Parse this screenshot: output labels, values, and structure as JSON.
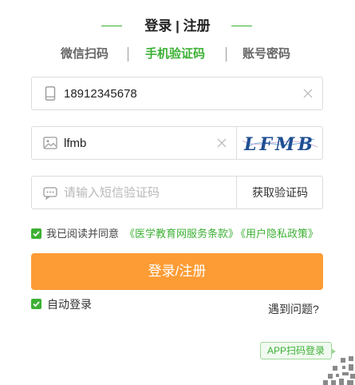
{
  "header": {
    "title": "登录 | 注册"
  },
  "tabs": [
    {
      "label": "微信扫码"
    },
    {
      "label": "手机验证码",
      "active": true
    },
    {
      "label": "账号密码"
    }
  ],
  "phone_field": {
    "value": "18912345678",
    "icon": "phone-icon"
  },
  "captcha_field": {
    "value": "lfmb",
    "icon": "image-icon",
    "captcha_text": "LFMB"
  },
  "sms_field": {
    "placeholder": "请输入短信验证码",
    "icon": "message-icon",
    "button_label": "获取验证码"
  },
  "agreement": {
    "prefix": "我已阅读并同意",
    "terms_link": "《医学教育网服务条款》",
    "privacy_link": "《用户隐私政策》",
    "checked": true
  },
  "submit": {
    "label": "登录/注册"
  },
  "auto_login": {
    "label": "自动登录",
    "checked": true
  },
  "help": {
    "label": "遇到问题?"
  },
  "app_login": {
    "label": "APP扫码登录"
  },
  "colors": {
    "accent_green": "#3cb034",
    "button_orange": "#fd9c35"
  }
}
